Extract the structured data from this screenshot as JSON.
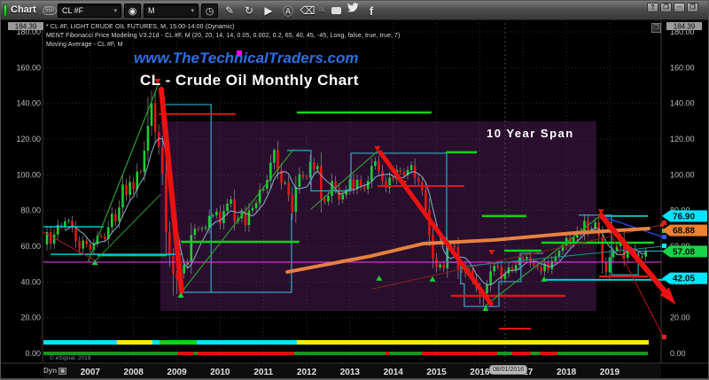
{
  "window": {
    "title": "Chart",
    "badge": "550",
    "buttons": {
      "help": "?",
      "restore": "❐",
      "minimize": "─",
      "maximize": "❐",
      "close": "✕"
    }
  },
  "toolbar": {
    "symbol": "CL #F",
    "interval": "M",
    "caret": "▾",
    "icons": [
      "symbol-lookup",
      "interval-clock",
      "pencil",
      "refresh",
      "play",
      "annotate-a",
      "eraser",
      "chat",
      "twitter",
      "facebook"
    ],
    "superscript": "01",
    "glyphs": {
      "lookup": "◉",
      "clock": "◷",
      "pencil": "✎",
      "refresh": "↻",
      "play": "▶",
      "annotate": "Ⓐ",
      "eraser": "⌫",
      "facebook": "f",
      "twitter": "🐦"
    }
  },
  "legend": {
    "line1": "* CL #F, LIGHT CRUDE OIL FUTURES, M, 15:00-14:00 (Dynamic)",
    "line2": "MENT Fibonacci Price Modeling V3.21d - CL #F, M (20, 20, 14, 14, 0.05, 0.002, 0.2, 65, 40, 45, -45, Long, false, true, true, 7)",
    "line3": "Moving Average - CL #F, M"
  },
  "titles": {
    "website": "www.TheTechnicalTraders.com",
    "chart_title": "CL - Crude Oil Monthly Chart",
    "span_label": "10 Year Span"
  },
  "axes": {
    "y_top_badge": "184.39",
    "y_ticks": [
      {
        "label": "180.00",
        "v": 180
      },
      {
        "label": "160.00",
        "v": 160
      },
      {
        "label": "140.00",
        "v": 140
      },
      {
        "label": "120.00",
        "v": 120
      },
      {
        "label": "100.00",
        "v": 100
      },
      {
        "label": "80.00",
        "v": 80
      },
      {
        "label": "60.00",
        "v": 60
      },
      {
        "label": "40.00",
        "v": 40
      },
      {
        "label": "20.00",
        "v": 20
      },
      {
        "label": "0.00",
        "v": 0
      }
    ],
    "x_years": [
      "2007",
      "2008",
      "2009",
      "2010",
      "2011",
      "2012",
      "2013",
      "2014",
      "2015",
      "2016",
      "2017",
      "2018",
      "2019"
    ],
    "x_left_label": "Dyn",
    "cursor_date": "08/01/2016",
    "cursor_month": 127
  },
  "price_badges": [
    {
      "value": "76.90",
      "color": "#00e5ff",
      "price": 76.9
    },
    {
      "value": "68.88",
      "color": "#f0822e",
      "price": 68.88
    },
    {
      "value": "57.08",
      "color": "#17d549",
      "price": 57.08
    },
    {
      "value": "42.05",
      "color": "#00e5ff",
      "price": 42.05
    }
  ],
  "copyright": "© eSignal, 2019",
  "chart_data": {
    "type": "candlestick",
    "title": "CL - Crude Oil Monthly Chart",
    "symbol": "CL #F  LIGHT CRUDE OIL FUTURES",
    "interval": "monthly",
    "start": "2006-01",
    "ylim": [
      0,
      184.39
    ],
    "closes": [
      67.9,
      61.4,
      66.6,
      71.9,
      71.3,
      73.9,
      74.4,
      70.3,
      62.9,
      58.7,
      63.1,
      61.1,
      58.1,
      61.8,
      65.9,
      65.7,
      64.0,
      70.7,
      78.2,
      74.0,
      81.7,
      94.5,
      88.7,
      96.0,
      91.8,
      101.8,
      101.6,
      113.5,
      127.4,
      140.0,
      124.1,
      115.5,
      100.6,
      67.8,
      54.4,
      44.6,
      41.7,
      44.8,
      49.7,
      51.1,
      66.3,
      69.9,
      69.5,
      70.0,
      70.6,
      77.0,
      77.3,
      79.4,
      72.9,
      79.7,
      83.8,
      86.2,
      74.0,
      75.6,
      79.0,
      71.9,
      80.0,
      81.4,
      84.1,
      91.4,
      92.2,
      97.0,
      106.7,
      113.9,
      102.7,
      95.4,
      95.7,
      88.8,
      79.2,
      93.2,
      100.4,
      98.8,
      98.5,
      107.1,
      103.0,
      104.9,
      86.5,
      85.0,
      88.1,
      96.5,
      92.2,
      86.2,
      88.9,
      91.8,
      97.5,
      92.1,
      97.2,
      93.5,
      92.0,
      96.6,
      105.0,
      107.7,
      102.3,
      96.4,
      92.7,
      98.4,
      97.5,
      102.6,
      101.6,
      99.7,
      102.7,
      105.4,
      98.2,
      96.0,
      91.2,
      80.5,
      66.2,
      53.3,
      48.2,
      49.8,
      47.6,
      59.6,
      60.3,
      59.5,
      47.1,
      49.2,
      45.1,
      46.6,
      41.7,
      37.0,
      33.6,
      33.7,
      38.3,
      45.9,
      49.1,
      48.3,
      41.6,
      44.7,
      48.2,
      46.9,
      49.4,
      53.7,
      52.8,
      54.0,
      50.6,
      49.3,
      48.3,
      46.0,
      50.2,
      47.2,
      51.7,
      54.4,
      57.4,
      60.4,
      64.7,
      61.6,
      64.9,
      68.6,
      67.0,
      74.2,
      68.8,
      69.8,
      73.3,
      65.3,
      50.9,
      45.4,
      53.8,
      57.2,
      60.1,
      63.9,
      53.5,
      58.5,
      58.6,
      55.1,
      54.1,
      54.2,
      57.08
    ],
    "extremes": {
      "29": {
        "h": 147.3
      },
      "28": {
        "h": 143.6
      },
      "35": {
        "l": 32.4
      },
      "36": {
        "l": 33.2
      },
      "63": {
        "h": 114.8
      },
      "120": {
        "l": 27.6
      },
      "121": {
        "l": 26.1
      },
      "153": {
        "h": 76.9
      }
    },
    "ma_period": 6,
    "overlays": {
      "span_box": {
        "m1": 31.4,
        "m2": 152.3,
        "p1": 130,
        "p2": 23.8,
        "fill": "rgba(135,50,150,0.30)"
      },
      "hlines": [
        {
          "m1": 31.0,
          "m2": 52.3,
          "p": 134.0,
          "color": "#e01616",
          "w": 2
        },
        {
          "m1": 91.6,
          "m2": 115.7,
          "p": 93.7,
          "color": "#e01616",
          "w": 2
        },
        {
          "m1": 112.0,
          "m2": 143.7,
          "p": 32.2,
          "color": "#e01616",
          "w": 2.5
        },
        {
          "m1": 153.1,
          "m2": 166.6,
          "p": 43.1,
          "color": "#e01616",
          "w": 2.5
        },
        {
          "m1": 125.3,
          "m2": 134.2,
          "p": 13.9,
          "color": "#e01616",
          "w": 2
        },
        {
          "m1": 69.3,
          "m2": 106.6,
          "p": 134.9,
          "color": "#11d411",
          "w": 2.5
        },
        {
          "m1": 14.0,
          "m2": 33.2,
          "p": 55.0,
          "color": "#11d411",
          "w": 2.5
        },
        {
          "m1": 37.1,
          "m2": 70.0,
          "p": 62.5,
          "color": "#11d411",
          "w": 2.5
        },
        {
          "m1": 110.6,
          "m2": 119.2,
          "p": 112.6,
          "color": "#11d411",
          "w": 2.5
        },
        {
          "m1": 120.6,
          "m2": 132.9,
          "p": 76.9,
          "color": "#11d411",
          "w": 2.5
        },
        {
          "m1": 126.8,
          "m2": 137.1,
          "p": 57.5,
          "color": "#11d411",
          "w": 2.5
        },
        {
          "m1": 137.1,
          "m2": 168.3,
          "p": 62.0,
          "color": "#11d411",
          "w": 2.5
        },
        {
          "m1": -1,
          "m2": 15.7,
          "p": 70.9,
          "color": "#00c8d8",
          "w": 1.5
        },
        {
          "m1": 1.0,
          "m2": 37.6,
          "p": 55.5,
          "color": "#00c8d8",
          "w": 1.5
        },
        {
          "m1": 153.8,
          "m2": 166.6,
          "p": 76.9,
          "color": "#19b8b8",
          "w": 2
        },
        {
          "m1": 137.6,
          "m2": 173.0,
          "p": 41.2,
          "color": "#00d0e0",
          "w": 2
        },
        {
          "m1": -1,
          "m2": 170.3,
          "p": 51.1,
          "color": "#e338e3",
          "w": 1.2
        }
      ],
      "trendlines": [
        {
          "pts": [
            [
              11.5,
              51.6
            ],
            [
              30.7,
              149.8
            ]
          ],
          "color": "#2f9e2f",
          "w": 1.2
        },
        {
          "pts": [
            [
              13.3,
              51.6
            ],
            [
              31.4,
              88.8
            ]
          ],
          "color": "#2f9e2f",
          "w": 1
        },
        {
          "pts": [
            [
              37.1,
              33.7
            ],
            [
              68.3,
              114.1
            ]
          ],
          "color": "#2f9e2f",
          "w": 1.2
        },
        {
          "pts": [
            [
              73.2,
              80.8
            ],
            [
              91.6,
              113.1
            ]
          ],
          "color": "#2f9e2f",
          "w": 1.2
        },
        {
          "pts": [
            [
              121.6,
              26.8
            ],
            [
              153.6,
              77.4
            ]
          ],
          "color": "#2f9e2f",
          "w": 1.2
        },
        {
          "pts": [
            [
              -1,
              67.9
            ],
            [
              13.3,
              52.1
            ]
          ],
          "color": "#b02020",
          "w": 1
        },
        {
          "pts": [
            [
              92.4,
              112.6
            ],
            [
              122.5,
              28.6
            ]
          ],
          "color": "#d03060",
          "w": 1
        },
        {
          "pts": [
            [
              153.6,
              77.3
            ],
            [
              171.0,
              8.9
            ]
          ],
          "color": "#cc1111",
          "w": 1,
          "sq": "#dd2222"
        },
        {
          "pts": [
            [
              90.4,
              36.2
            ],
            [
              170.5,
              71.9
            ]
          ],
          "color": "#8a2020",
          "w": 1,
          "sq": "#dd2222"
        },
        {
          "pts": [
            [
              153.6,
              76.9
            ],
            [
              171.0,
              65.0
            ]
          ],
          "color": "#2745d8",
          "w": 1.5,
          "sq": "#3355ee"
        },
        {
          "pts": [
            [
              115.0,
              48.6
            ],
            [
              171.0,
              60.0
            ]
          ],
          "color": "#1f9090",
          "w": 1,
          "sq": "#00e5ff"
        },
        {
          "pts": [
            [
              66.6,
              45.6
            ],
            [
              89.8,
              54.5
            ],
            [
              104.4,
              61.5
            ],
            [
              123.9,
              63.5
            ],
            [
              145.9,
              67.4
            ],
            [
              166.8,
              69.9
            ]
          ],
          "color": "#e8813f",
          "w": 4
        }
      ],
      "arrows": [
        {
          "pts": [
            [
              31.7,
              147.8
            ],
            [
              37.3,
              34.7
            ]
          ],
          "w": 6,
          "head": false
        },
        {
          "pts": [
            [
              92.4,
              112.6
            ],
            [
              123.1,
              27.8
            ]
          ],
          "w": 5,
          "head": false
        },
        {
          "pts": [
            [
              153.6,
              77.3
            ],
            [
              172.6,
              31.5
            ]
          ],
          "w": 6,
          "head": true
        }
      ],
      "steps": [
        {
          "pts": [
            [
              32.2,
              139.3
            ],
            [
              45.5,
              139.3
            ],
            [
              45.5,
              34.2
            ]
          ]
        },
        {
          "pts": [
            [
              37.1,
              34.2
            ],
            [
              67.8,
              34.2
            ],
            [
              67.8,
              78.3
            ]
          ]
        },
        {
          "pts": [
            [
              66.6,
              113.6
            ],
            [
              73.2,
              113.6
            ],
            [
              73.2,
              91.0
            ],
            [
              84.3,
              91.0
            ],
            [
              84.3,
              112.1
            ],
            [
              110.8,
              112.1
            ],
            [
              110.8,
              51.0
            ],
            [
              114.7,
              51.0
            ],
            [
              114.7,
              39.0
            ],
            [
              115.7,
              39.0
            ],
            [
              115.7,
              26.3
            ],
            [
              125.3,
              26.3
            ],
            [
              125.3,
              40.2
            ],
            [
              131.4,
              40.2
            ],
            [
              131.4,
              56.0
            ],
            [
              137.6,
              56.0
            ]
          ]
        },
        {
          "pts": [
            [
              147.4,
              77.4
            ],
            [
              156.5,
              77.4
            ],
            [
              156.5,
              44.0
            ],
            [
              163.9,
              44.0
            ],
            [
              163.9,
              57.3
            ],
            [
              171.5,
              57.3
            ]
          ]
        }
      ],
      "markers_up": [
        [
          13.3,
          51.0
        ],
        [
          37.1,
          32.7
        ],
        [
          92.1,
          42.2
        ],
        [
          106.9,
          41.7
        ],
        [
          121.6,
          25.3
        ],
        [
          137.8,
          41.7
        ]
      ],
      "markers_down": [
        [
          30.7,
          152.2
        ],
        [
          91.6,
          114.6
        ],
        [
          99.0,
          95.2
        ],
        [
          123.3,
          56.5
        ],
        [
          153.6,
          79.3
        ]
      ],
      "edge_squares": [
        [
          746,
          250,
          "#dd2222"
        ],
        [
          746,
          259,
          "#22cc44"
        ],
        [
          746,
          266,
          "#3355ee"
        ],
        [
          746,
          276,
          "#00e5ff"
        ],
        [
          746,
          379,
          "#dd2222"
        ]
      ],
      "strips": [
        {
          "y": 383,
          "h": 5,
          "segs": [
            [
              48,
              131,
              "#00e5ff"
            ],
            [
              131,
              171,
              "#f5ef08"
            ],
            [
              171,
              179,
              "#00e5ff"
            ],
            [
              179,
              221,
              "#12d412"
            ],
            [
              221,
              334,
              "#00e5ff"
            ],
            [
              334,
              731,
              "#f5ef08"
            ]
          ]
        },
        {
          "y": 396,
          "h": 4,
          "segs": [
            [
              48,
              199,
              "#0d9a1d"
            ],
            [
              199,
              218,
              "#dd1111"
            ],
            [
              218,
              222,
              "#0d9a1d"
            ],
            [
              222,
              331,
              "#dd1111"
            ],
            [
              331,
              434,
              "#0d9a1d"
            ],
            [
              434,
              439,
              "#dd1111"
            ],
            [
              439,
              475,
              "#0d9a1d"
            ],
            [
              475,
              560,
              "#dd1111"
            ],
            [
              560,
              577,
              "#0d9a1d"
            ],
            [
              577,
              598,
              "#dd1111"
            ],
            [
              598,
              608,
              "#0d9a1d"
            ],
            [
              608,
              628,
              "#dd1111"
            ],
            [
              628,
              730,
              "#0d9a1d"
            ]
          ]
        }
      ]
    }
  }
}
